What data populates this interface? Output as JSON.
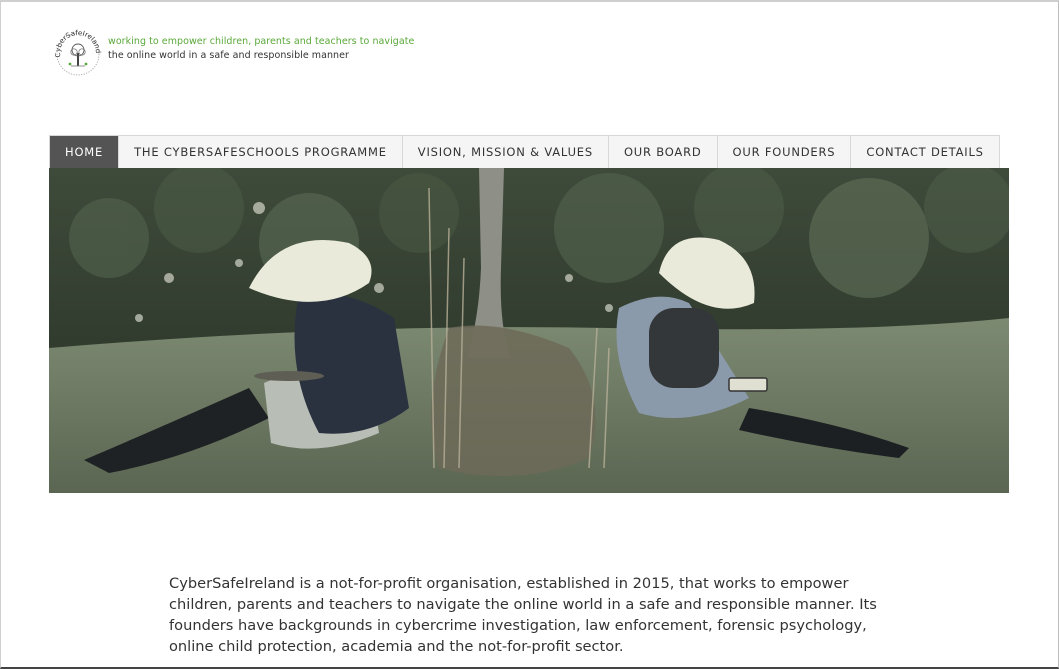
{
  "header": {
    "logo_text": "CyberSafeIreland",
    "tagline_line1": "working to empower children, parents and teachers to navigate",
    "tagline_line2": "the online world in a safe and responsible manner"
  },
  "nav": {
    "items": [
      {
        "label": "HOME",
        "active": true
      },
      {
        "label": "THE CYBERSAFESCHOOLS PROGRAMME",
        "active": false
      },
      {
        "label": "VISION, MISSION & VALUES",
        "active": false
      },
      {
        "label": "OUR BOARD",
        "active": false
      },
      {
        "label": "OUR FOUNDERS",
        "active": false
      },
      {
        "label": "CONTACT DETAILS",
        "active": false
      }
    ]
  },
  "intro": {
    "text": "CyberSafeIreland is a not-for-profit organisation, established in 2015, that works to empower children, parents and teachers to navigate the online world in a safe and responsible manner. Its founders have backgrounds in cybercrime investigation, law enforcement, forensic psychology, online child protection, academia and the not-for-profit sector."
  },
  "colors": {
    "tagline_green": "#5aa83a",
    "nav_active_bg": "#545454",
    "nav_bg": "#f5f5f5",
    "body_text": "#333333"
  },
  "icons": {
    "logo": "tree-in-circle-logo-icon"
  }
}
